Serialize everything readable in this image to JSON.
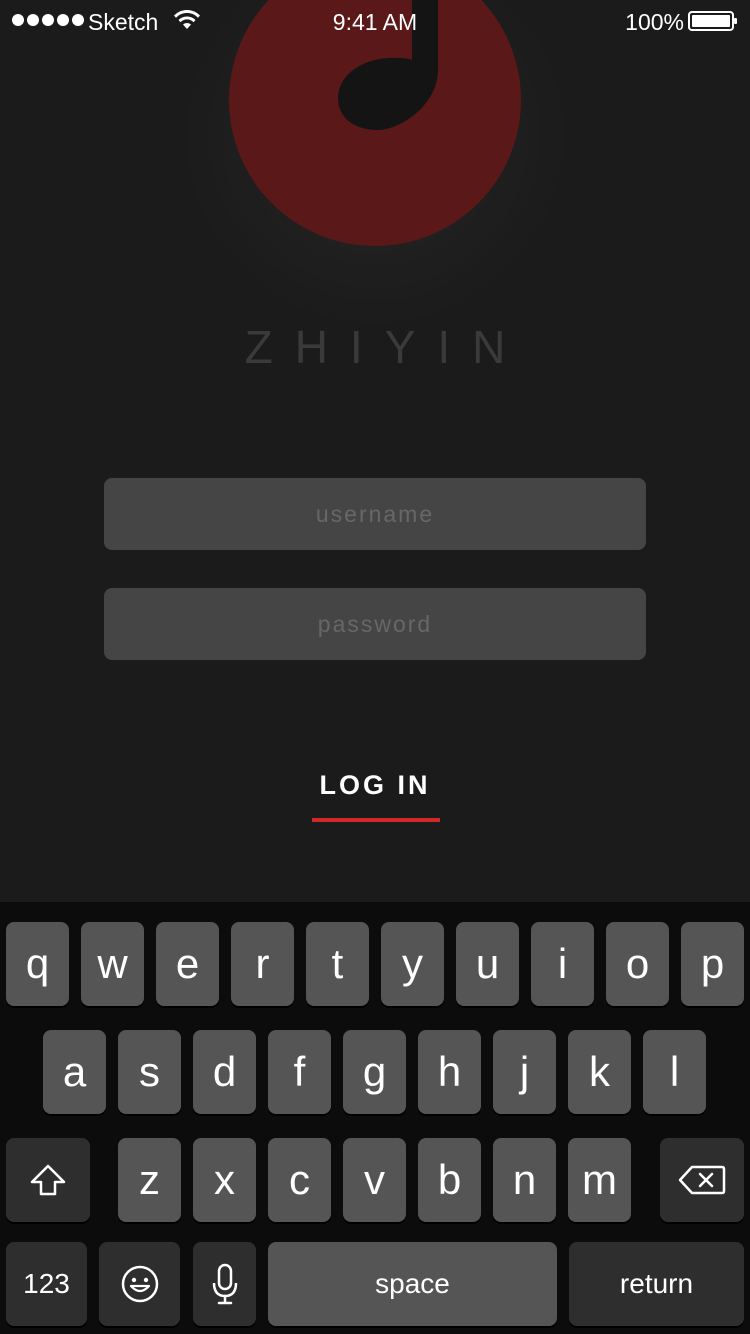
{
  "status_bar": {
    "carrier": "Sketch",
    "time": "9:41 AM",
    "battery": "100%"
  },
  "app": {
    "name": "ZHIYIN",
    "accent": "#d0282a",
    "logo_color": "#5b1818"
  },
  "form": {
    "username_placeholder": "username",
    "password_placeholder": "password",
    "username_value": "",
    "password_value": "",
    "login_label": "LOG IN"
  },
  "keyboard": {
    "row1": [
      "q",
      "w",
      "e",
      "r",
      "t",
      "y",
      "u",
      "i",
      "o",
      "p"
    ],
    "row2": [
      "a",
      "s",
      "d",
      "f",
      "g",
      "h",
      "j",
      "k",
      "l"
    ],
    "row3": [
      "z",
      "x",
      "c",
      "v",
      "b",
      "n",
      "m"
    ],
    "numbers_label": "123",
    "space_label": "space",
    "return_label": "return",
    "icons": {
      "shift": "shift-icon",
      "delete": "delete-icon",
      "emoji": "emoji-icon",
      "microphone": "microphone-icon"
    }
  }
}
